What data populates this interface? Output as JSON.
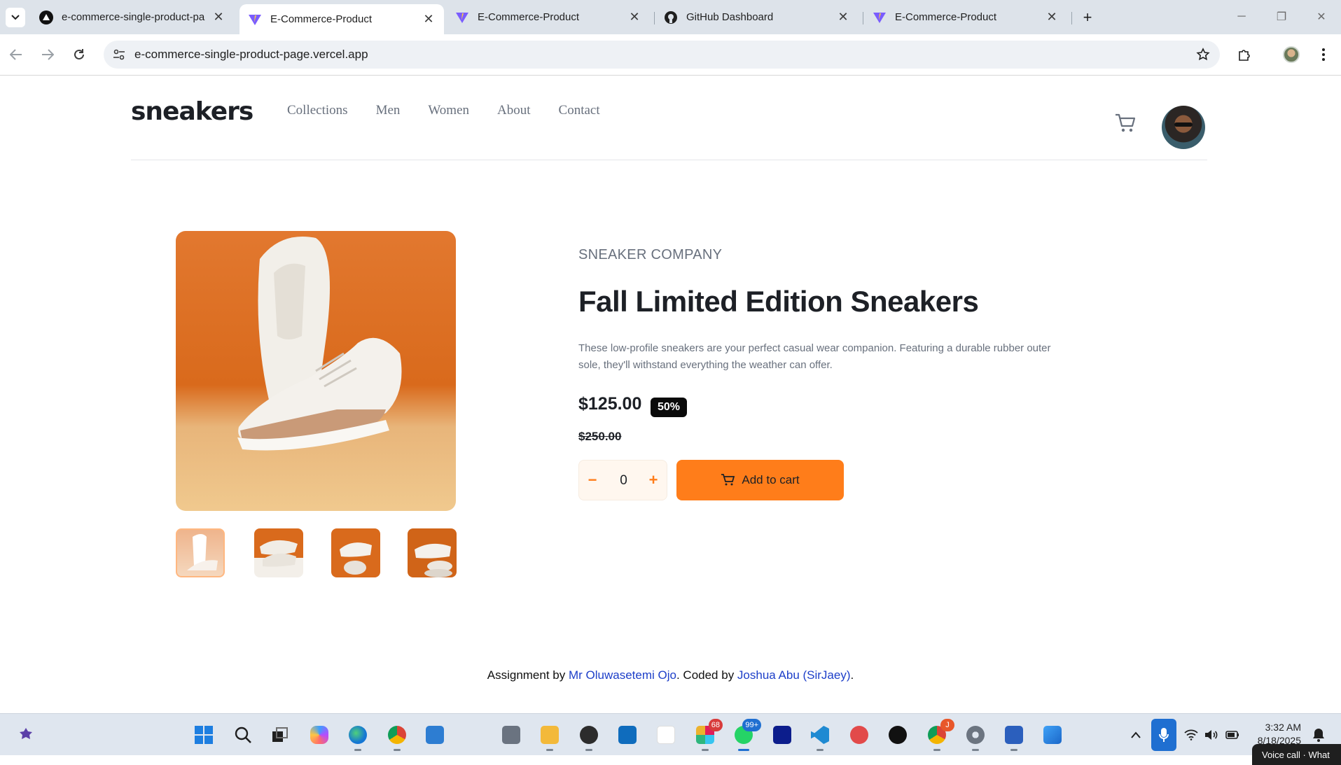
{
  "browser": {
    "tabs": [
      {
        "title": "e-commerce-single-product-pa",
        "icon": "vercel-triangle-icon",
        "active": false
      },
      {
        "title": "E-Commerce-Product",
        "icon": "vite-icon",
        "active": true
      },
      {
        "title": "E-Commerce-Product",
        "icon": "vite-icon",
        "active": false
      },
      {
        "title": "GitHub Dashboard",
        "icon": "github-icon",
        "active": false
      },
      {
        "title": "E-Commerce-Product",
        "icon": "vite-icon",
        "active": false
      }
    ],
    "url": "e-commerce-single-product-page.vercel.app"
  },
  "site": {
    "logo": "sneakers",
    "nav": [
      "Collections",
      "Men",
      "Women",
      "About",
      "Contact"
    ]
  },
  "product": {
    "company": "SNEAKER COMPANY",
    "title": "Fall Limited Edition Sneakers",
    "description": "These low-profile sneakers are your perfect casual wear companion. Featuring a durable rubber outer sole, they'll withstand everything the weather can offer.",
    "price": "$125.00",
    "discount": "50%",
    "old_price": "$250.00",
    "quantity": "0",
    "minus": "−",
    "plus": "+",
    "add_to_cart": "Add to cart"
  },
  "footer": {
    "prefix": "Assignment by ",
    "author": "Mr Oluwasetemi Ojo",
    "middle": ". Coded by ",
    "coder": "Joshua Abu (SirJaey)",
    "suffix": "."
  },
  "taskbar": {
    "time": "3:32 AM",
    "date": "8/18/2025",
    "badges": {
      "slack": "68",
      "whatsapp": "99+",
      "chrome": "J"
    },
    "voice_popup": "Voice call · What"
  },
  "colors": {
    "accent": "#ff7d1a",
    "text_dark": "#1d2026",
    "text_grey": "#68707d"
  }
}
